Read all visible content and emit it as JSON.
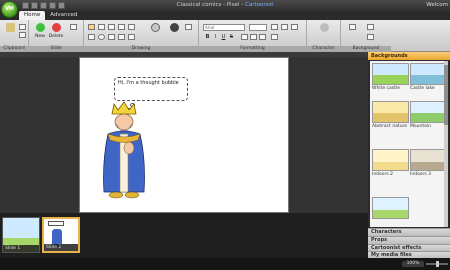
{
  "window": {
    "app_title": "Classical comics",
    "separator": " - ",
    "app_name": "Pixel",
    "product": "Cartoonist",
    "welcome": "Welcom"
  },
  "logo_text": "VM",
  "tabs": [
    "Home",
    "Advanced"
  ],
  "ribbon": {
    "groups": [
      "Clipboard",
      "Slide",
      "Drawing",
      "Formatting",
      "Character",
      "Background"
    ],
    "new_label": "New",
    "delete_label": "Delete",
    "font_placeholder": "Arial",
    "bold": "B",
    "italic": "I",
    "underline": "U",
    "strike": "S"
  },
  "canvas": {
    "bubble_text": "Hi, I'm a thought bubble"
  },
  "slides": [
    {
      "label": "Slide 1"
    },
    {
      "label": "Slide 2"
    }
  ],
  "panel": {
    "header": "Backgrounds",
    "items": [
      {
        "caption": "White castle",
        "sky": "#cfe9ff",
        "ground": "#9ad35a"
      },
      {
        "caption": "Castle lake",
        "sky": "#cfe9ff",
        "ground": "#7fc0d8"
      },
      {
        "caption": "Abstract nature",
        "sky": "#fbe9a8",
        "ground": "#e2c46a"
      },
      {
        "caption": "Mountain",
        "sky": "#dff0ff",
        "ground": "#8fcc6a"
      },
      {
        "caption": "Indoors 2",
        "sky": "#fff4c9",
        "ground": "#f2dc8c"
      },
      {
        "caption": "Indoors 3",
        "sky": "#e8e2d2",
        "ground": "#b7a98d"
      },
      {
        "caption": "",
        "sky": "#dff2ff",
        "ground": "#a8d86a"
      }
    ],
    "sections": [
      "Characters",
      "Props",
      "Cartoonist effects",
      "My media files"
    ]
  },
  "status": {
    "zoom": "100%"
  }
}
